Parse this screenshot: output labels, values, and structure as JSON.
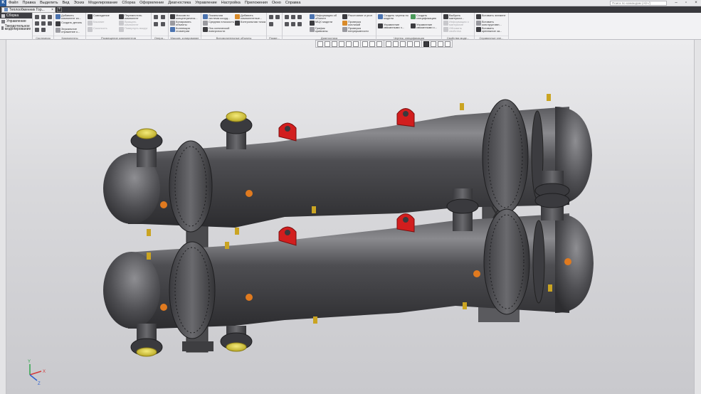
{
  "menu": {
    "items": [
      "Файл",
      "Правка",
      "Выделить",
      "Вид",
      "Эскиз",
      "Моделирование",
      "Сборка",
      "Оформление",
      "Диагностика",
      "Управление",
      "Настройка",
      "Приложения",
      "Окно",
      "Справка"
    ],
    "search_placeholder": "Поиск по командам (Alt+/)"
  },
  "tabs": {
    "document": "Теплообменник Гор...",
    "close": "×",
    "add": "+"
  },
  "ribbon": {
    "tabs": [
      "Сборка",
      "Управление",
      "Твердотельное моделирование"
    ],
    "panels": {
      "system": {
        "title": "Системная"
      },
      "components": {
        "title": "Компоненты",
        "buttons": [
          "Добавить компонент из...",
          "Создать деталь",
          "Зеркальное отражение к..."
        ]
      },
      "placement": {
        "title": "Размещение компонентов",
        "buttons": [
          "Совпадение",
          "Касание",
          "Соосность",
          "Переместить компонент",
          "Вращать компонент",
          "Повернуть вокруг",
          "Отклонить вокруг"
        ]
      },
      "operations": {
        "title": "Опера..."
      },
      "copy": {
        "title": "Массив, копирование",
        "buttons": [
          "Массив по концентрическ...",
          "Копировать объекты",
          "Коллекция геометрии"
        ]
      },
      "aux": {
        "title": "Вспомогательные объекты",
        "buttons": [
          "Локальная система коорд...",
          "Средняя плоскость",
          "Ось конической поверхности",
          "Добавить компонентные...",
          "Контрольная точка"
        ]
      },
      "sizes": {
        "title": "Разме..."
      },
      "diagnostics": {
        "title": "Диагностика",
        "buttons": [
          "Информация об объекте",
          "МЦХ модели",
          "График кривизны",
          "Расстояние и угол",
          "Проверка коллизий",
          "Проверка непрерывности"
        ]
      },
      "drawing": {
        "title": "Чертеж, спецификация",
        "buttons": [
          "Создать чертеж по модели",
          "Создать спецификацию",
          "Управление связанными ч...",
          "Управление связанными с..."
        ]
      },
      "options": {
        "title": "Свойства моде...",
        "buttons": [
          "Выбрать материал...",
          "Информация о материале",
          "Обновить свойства",
          "Установить отображение"
        ]
      },
      "elements": {
        "title": "Справочные эле...",
        "buttons": [
          "Вставить элемент",
          "Вставить конструктивн...",
          "Вставить крепежное за..."
        ]
      }
    }
  },
  "viewport": {
    "axis_labels": [
      "Y",
      "X",
      "Z"
    ],
    "toolbar_icons": [
      "zoom-fit-icon",
      "zoom-area-icon",
      "pan-icon",
      "rotate-icon",
      "view-orientation-icon",
      "display-style-icon",
      "section-icon",
      "filter-icon",
      "settings-icon"
    ]
  },
  "colors": {
    "vessel": "#4a4a4d",
    "flange_highlight": "#e2d54a",
    "lifting_lug": "#d21e1e",
    "nozzle_cap": "#e07a1f"
  }
}
